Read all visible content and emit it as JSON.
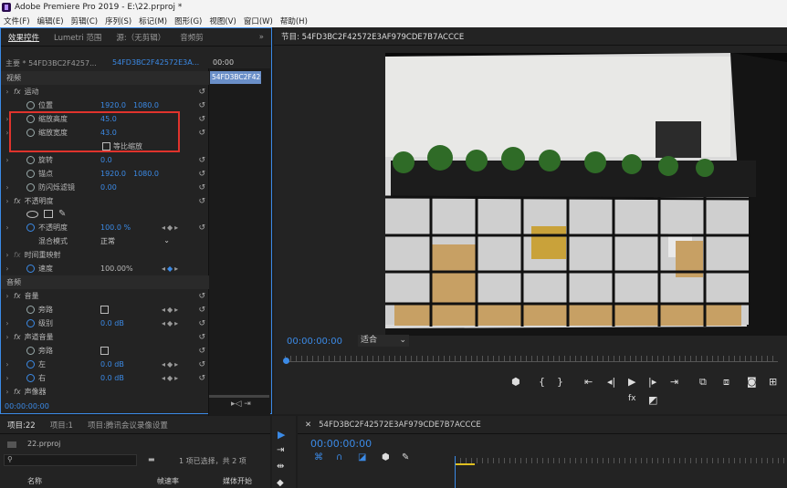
{
  "window": {
    "title": "Adobe Premiere Pro 2019 - E:\\22.prproj *"
  },
  "menu": [
    "文件(F)",
    "编辑(E)",
    "剪辑(C)",
    "序列(S)",
    "标记(M)",
    "图形(G)",
    "视图(V)",
    "窗口(W)",
    "帮助(H)"
  ],
  "effects_panel": {
    "tabs": [
      "效果控件",
      "Lumetri 范围",
      "源:（无剪辑）",
      "音频剪"
    ],
    "active_tab": "效果控件",
    "master_label": "主要 * 54FD3BC2F4257...",
    "clip_label": "54FD3BC2F42572E3A...",
    "timecode_top": "00:00",
    "clip_chip": "54FD3BC2F42",
    "video_header": "视频",
    "motion": {
      "label": "运动",
      "position_label": "位置",
      "position_x": "1920.0",
      "position_y": "1080.0",
      "scale_h_label": "缩放高度",
      "scale_h": "45.0",
      "scale_w_label": "缩放宽度",
      "scale_w": "43.0",
      "uniform_label": "等比缩放",
      "rotation_label": "旋转",
      "rotation": "0.0",
      "anchor_label": "锚点",
      "anchor_x": "1920.0",
      "anchor_y": "1080.0",
      "antiflicker_label": "防闪烁滤镜",
      "antiflicker": "0.00"
    },
    "opacity": {
      "label": "不透明度",
      "opacity_label": "不透明度",
      "opacity_value": "100.0 %",
      "blend_label": "混合模式",
      "blend_value": "正常"
    },
    "time_remap": {
      "label": "时间重映射",
      "speed_label": "速度",
      "speed_value": "100.00%"
    },
    "audio_header": "音频",
    "volume": {
      "label": "音量",
      "bypass_label": "旁路",
      "level_label": "级别",
      "level_value": "0.0 dB"
    },
    "channel_volume": {
      "label": "声道音量",
      "bypass_label": "旁路",
      "left_label": "左",
      "left_value": "0.0 dB",
      "right_label": "右",
      "right_value": "0.0 dB"
    },
    "panner": {
      "label": "声像器"
    },
    "timecode_bottom": "00:00:00:00"
  },
  "program": {
    "tab": "节目: 54FD3BC2F42572E3AF979CDE7B7ACCCE",
    "timecode": "00:00:00:00",
    "fit": "适合"
  },
  "project": {
    "tabs": [
      "项目:22",
      "项目:1",
      "项目:腾讯会议录像设置"
    ],
    "file": "22.prproj",
    "selection": "1 项已选择，共 2 项",
    "col_name": "名称",
    "col_rate": "帧速率",
    "col_media": "媒体开始"
  },
  "sequence": {
    "tab": "54FD3BC2F42572E3AF979CDE7B7ACCCE",
    "timecode": "00:00:00:00"
  },
  "colors": {
    "accent": "#3b8ae6",
    "highlight": "#e0332c"
  }
}
